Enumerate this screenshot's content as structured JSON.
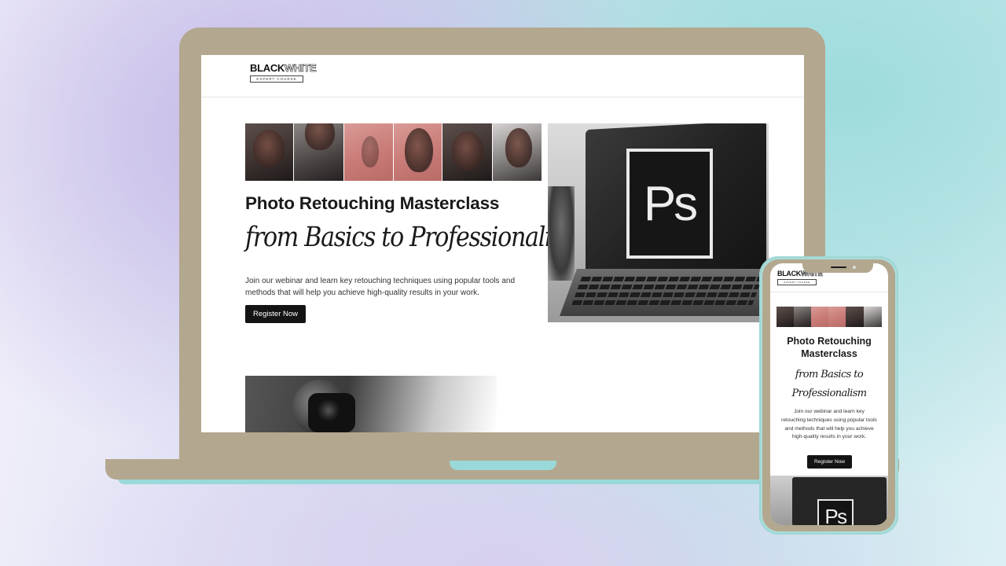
{
  "brand": {
    "logo_black": "BLACK",
    "logo_white": "WHITE",
    "logo_sub": "EXPERT COURSE"
  },
  "hero": {
    "title": "Photo Retouching Masterclass",
    "script": "from Basics to Professionalism",
    "description": "Join our webinar and learn key retouching techniques using popular tools and methods that will help you achieve high-quality results in your work.",
    "cta_label": "Register Now",
    "ps_logo_text": "Ps"
  },
  "mobile": {
    "title": "Photo Retouching Masterclass",
    "script": "from Basics to Professionalism",
    "description": "Join our webinar and learn key retouching techniques using popular tools and methods that will help you achieve high-quality results in your work.",
    "cta_label": "Register Now",
    "ps_logo_text": "Ps"
  },
  "colors": {
    "device_frame": "#b3a88f",
    "accent_teal": "#9ad9d9",
    "button_bg": "#141414",
    "rose_tone": "#c97b77"
  },
  "icons": [
    "photoshop-logo"
  ]
}
